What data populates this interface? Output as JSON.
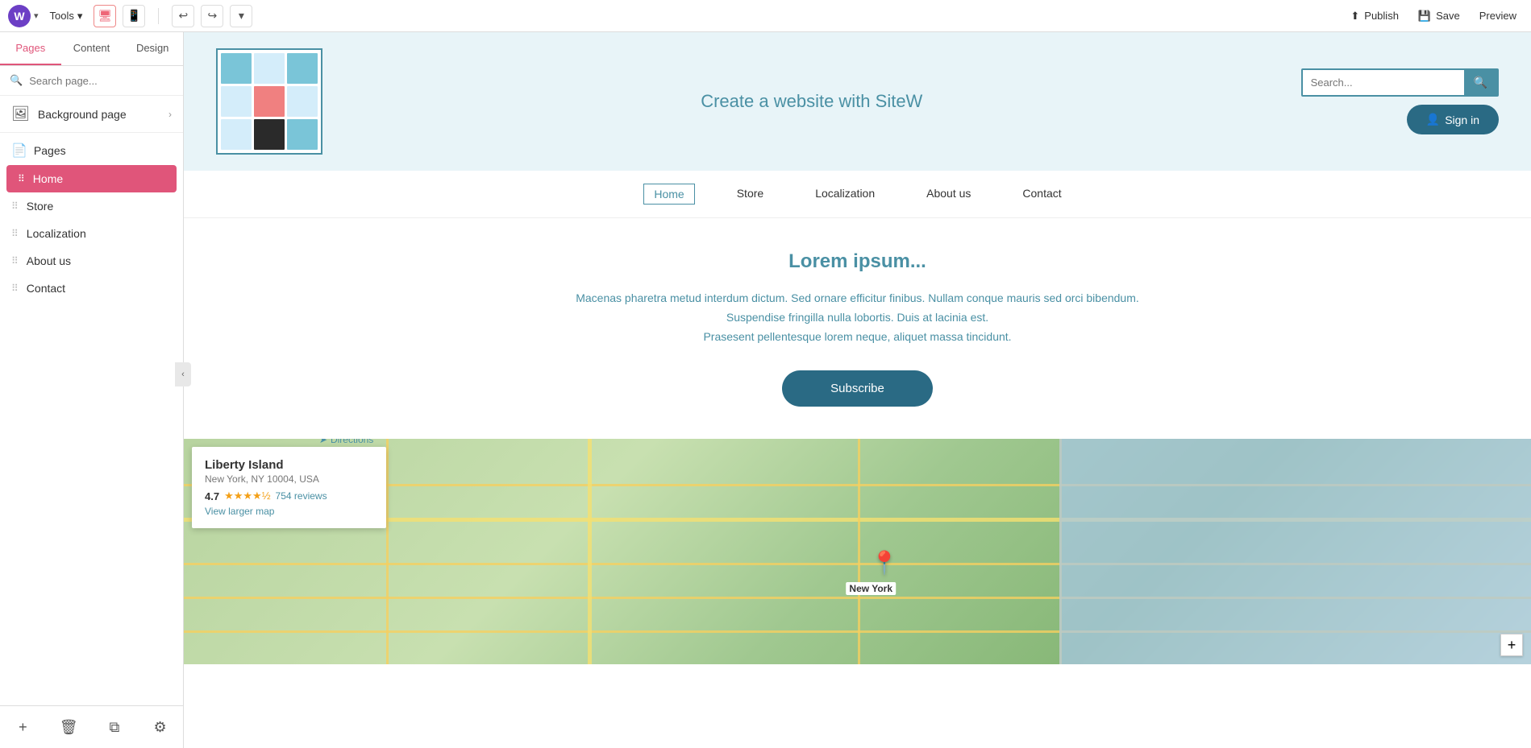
{
  "toolbar": {
    "logo_letter": "W",
    "tools_label": "Tools",
    "publish_label": "Publish",
    "save_label": "Save",
    "preview_label": "Preview"
  },
  "sidebar": {
    "tab_pages": "Pages",
    "tab_content": "Content",
    "tab_design": "Design",
    "search_placeholder": "Search page...",
    "background_page_label": "Background page",
    "pages_section_label": "Pages",
    "pages": [
      {
        "label": "Home",
        "active": true
      },
      {
        "label": "Store",
        "active": false
      },
      {
        "label": "Localization",
        "active": false
      },
      {
        "label": "About us",
        "active": false
      },
      {
        "label": "Contact",
        "active": false
      }
    ]
  },
  "site_header": {
    "title": "Create a website with SiteW",
    "search_placeholder": "Search...",
    "signin_label": "Sign in"
  },
  "site_nav": {
    "items": [
      {
        "label": "Home",
        "active": true
      },
      {
        "label": "Store",
        "active": false
      },
      {
        "label": "Localization",
        "active": false
      },
      {
        "label": "About us",
        "active": false
      },
      {
        "label": "Contact",
        "active": false
      }
    ]
  },
  "site_content": {
    "title": "Lorem ipsum...",
    "body_line1": "Macenas pharetra metud interdum dictum. Sed ornare efficitur finibus. Nullam conque mauris sed orci bibendum.",
    "body_line2": "Suspendise fringilla nulla lobortis. Duis at lacinia est.",
    "body_line3": "Prasesent pellentesque lorem neque, aliquet massa tincidunt.",
    "subscribe_label": "Subscribe"
  },
  "map": {
    "location_name": "Liberty Island",
    "location_address": "New York, NY 10004, USA",
    "rating": "4.7",
    "stars": "★★★★½",
    "reviews_label": "754 reviews",
    "directions_label": "Directions",
    "view_larger_label": "View larger map",
    "city_label": "New York",
    "plus_label": "+"
  }
}
